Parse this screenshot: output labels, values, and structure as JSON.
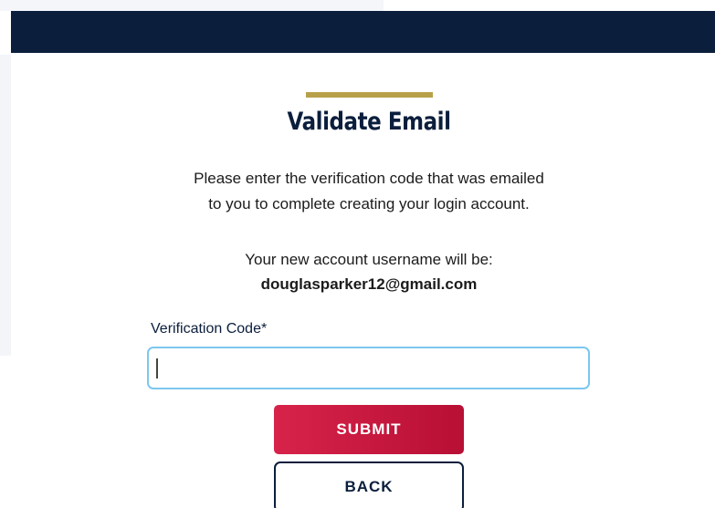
{
  "header": {
    "bar_color": "#0b1e3c",
    "accent_color": "#b8a04a"
  },
  "main": {
    "title": "Validate Email",
    "instruction_line1": "Please enter the verification code that was emailed",
    "instruction_line2": "to you to complete creating your login account.",
    "username_intro": "Your new account username will be:",
    "username_value": "douglasparker12@gmail.com"
  },
  "form": {
    "verification_label": "Verification Code*",
    "verification_value": "",
    "input_border_color": "#7cc7ee"
  },
  "actions": {
    "submit_label": "SUBMIT",
    "submit_color": "#d01c44",
    "back_label": "BACK"
  }
}
